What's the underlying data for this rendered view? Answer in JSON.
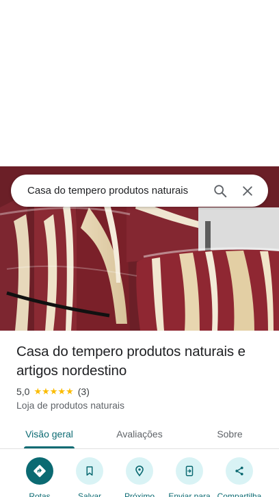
{
  "search": {
    "query": "Casa do tempero produtos naturais"
  },
  "place": {
    "name": "Casa do tempero produtos naturais e artigos nordestino",
    "rating": "5,0",
    "stars": "★★★★★",
    "review_count": "(3)",
    "category": "Loja de produtos naturais"
  },
  "tabs": [
    "Visão geral",
    "Avaliações",
    "Sobre"
  ],
  "actions": [
    {
      "label": "Rotas",
      "icon": "directions-icon"
    },
    {
      "label": "Salvar",
      "icon": "bookmark-icon"
    },
    {
      "label": "Próximo",
      "icon": "nearby-icon"
    },
    {
      "label": "Enviar para",
      "icon": "send-to-phone-icon"
    },
    {
      "label": "Compartilha",
      "icon": "share-icon"
    }
  ],
  "colors": {
    "accent": "#0b6a72",
    "accent_light": "#d9f3f5",
    "star": "#fbbc04"
  }
}
